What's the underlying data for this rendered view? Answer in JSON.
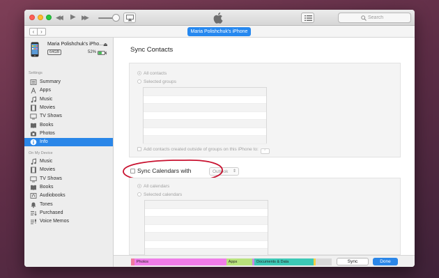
{
  "toolbar": {
    "rewind_glyph": "◀◀",
    "play_glyph": "▶",
    "forward_glyph": "▶▶",
    "search_placeholder": "Search"
  },
  "navbar": {
    "back_glyph": "‹",
    "forward_glyph": "›",
    "device_pill_label": "Maria Polishchuk's iPhone"
  },
  "sidebar": {
    "device_name": "Maria Polishchuk's iPho...",
    "eject_glyph": "⏏",
    "capacity": "64GB",
    "battery": "52%",
    "settings_label": "Settings",
    "settings_items": [
      {
        "label": "Summary",
        "icon": "summary-icon"
      },
      {
        "label": "Apps",
        "icon": "apps-icon"
      },
      {
        "label": "Music",
        "icon": "music-icon"
      },
      {
        "label": "Movies",
        "icon": "movies-icon"
      },
      {
        "label": "TV Shows",
        "icon": "tv-shows-icon"
      },
      {
        "label": "Books",
        "icon": "books-icon"
      },
      {
        "label": "Photos",
        "icon": "photos-icon"
      },
      {
        "label": "Info",
        "icon": "info-icon",
        "selected": true
      }
    ],
    "on_device_label": "On My Device",
    "device_items": [
      {
        "label": "Music",
        "icon": "music-icon"
      },
      {
        "label": "Movies",
        "icon": "movies-icon"
      },
      {
        "label": "TV Shows",
        "icon": "tv-shows-icon"
      },
      {
        "label": "Books",
        "icon": "books-icon"
      },
      {
        "label": "Audiobooks",
        "icon": "audiobooks-icon"
      },
      {
        "label": "Tones",
        "icon": "tones-icon"
      },
      {
        "label": "Purchased",
        "icon": "purchased-icon"
      },
      {
        "label": "Voice Memos",
        "icon": "voice-memos-icon"
      }
    ]
  },
  "main": {
    "sync_contacts_heading": "Sync Contacts",
    "all_contacts": "All contacts",
    "selected_groups": "Selected groups",
    "add_contacts_label": "Add contacts created outside of groups on this iPhone to:",
    "sync_calendars_label": "Sync Calendars with",
    "calendars_source": "Outlook",
    "all_calendars": "All calendars",
    "selected_calendars": "Selected calendars"
  },
  "bottom": {
    "storage": [
      {
        "label": "",
        "color": "#f07aa0",
        "fraction": 0.017
      },
      {
        "label": "Photos",
        "color": "#f07ce8",
        "fraction": 0.458
      },
      {
        "label": "Apps",
        "color": "#b8e27c",
        "fraction": 0.128
      },
      {
        "label": "",
        "color": "#c88de4",
        "fraction": 0.012
      },
      {
        "label": "Documents & Data",
        "color": "#3cc9b6",
        "fraction": 0.295
      },
      {
        "label": "",
        "color": "#f6d046",
        "fraction": 0.01
      },
      {
        "label": "",
        "color": "#d9d9d9",
        "fraction": 0.08
      }
    ],
    "sync_label": "Sync",
    "done_label": "Done"
  },
  "colors": {
    "accent": "#2a86e8",
    "annotation": "#c8102e"
  }
}
